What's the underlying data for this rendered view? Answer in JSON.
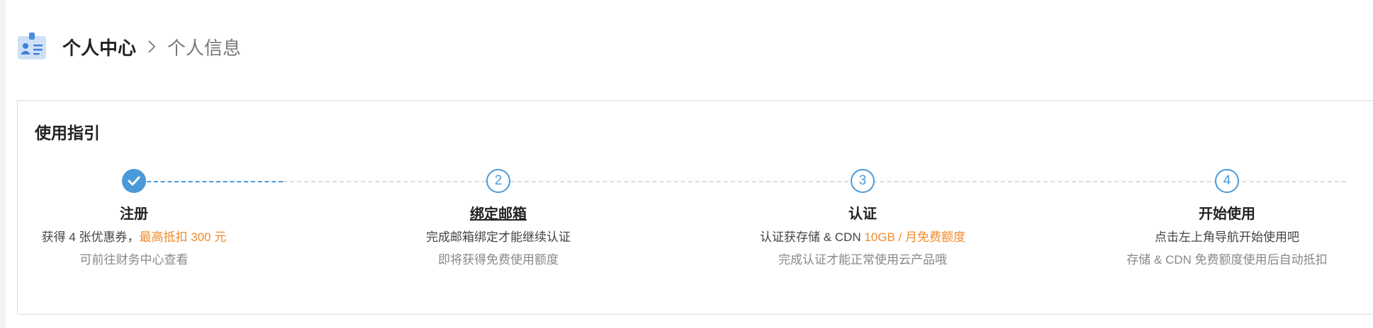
{
  "breadcrumb": {
    "root": "个人中心",
    "current": "个人信息"
  },
  "icons": {
    "header": "id-card-icon",
    "separator": "chevron-right-icon",
    "done": "check-icon"
  },
  "colors": {
    "accent": "#4a9ad9",
    "highlight": "#f08a2c"
  },
  "guide": {
    "title": "使用指引",
    "steps": [
      {
        "status": "done",
        "number": "1",
        "title": "注册",
        "desc_prefix": "获得 4 张优惠券，",
        "desc_highlight": "最高抵扣 300 元",
        "sub": "可前往财务中心查看"
      },
      {
        "status": "pending",
        "number": "2",
        "title": "绑定邮箱",
        "desc_prefix": "完成邮箱绑定才能继续认证",
        "desc_highlight": "",
        "sub": "即将获得免费使用额度"
      },
      {
        "status": "pending",
        "number": "3",
        "title": "认证",
        "desc_prefix": "认证获存储 & CDN ",
        "desc_highlight": "10GB / 月免费额度",
        "sub": "完成认证才能正常使用云产品哦"
      },
      {
        "status": "pending",
        "number": "4",
        "title": "开始使用",
        "desc_prefix": "点击左上角导航开始使用吧",
        "desc_highlight": "",
        "sub": "存储 & CDN 免费额度使用后自动抵扣"
      }
    ]
  }
}
